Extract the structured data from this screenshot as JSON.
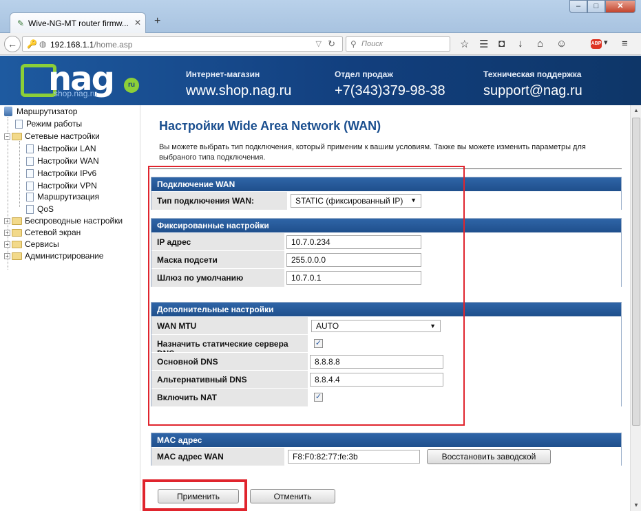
{
  "browser": {
    "tab_title": "Wive-NG-MT router firmw...",
    "url_host": "192.168.1.1",
    "url_path": "/home.asp",
    "search_placeholder": "Поиск"
  },
  "banner": {
    "logo_text": "nag",
    "logo_site": "shop.nag.ru",
    "logo_badge": "ru",
    "col1_head": "Интернет-магазин",
    "col1_val": "www.shop.nag.ru",
    "col2_head": "Отдел продаж",
    "col2_val": "+7(343)379-98-38",
    "col3_head": "Техническая поддержка",
    "col3_val": "support@nag.ru"
  },
  "sidebar": {
    "root": "Маршрутизатор",
    "items": [
      "Режим работы",
      "Сетевые настройки",
      "Настройки LAN",
      "Настройки WAN",
      "Настройки IPv6",
      "Настройки VPN",
      "Маршрутизация",
      "QoS",
      "Беспроводные настройки",
      "Сетевой экран",
      "Сервисы",
      "Администрирование"
    ]
  },
  "page": {
    "title": "Настройки Wide Area Network (WAN)",
    "description": "Вы можете выбрать тип подключения, который применим к вашим условиям. Также вы можете изменить параметры для выбраного типа подключения."
  },
  "wan": {
    "header": "Подключение WAN",
    "type_label": "Тип подключения WAN:",
    "type_value": "STATIC (фиксированный IP)"
  },
  "fixed": {
    "header": "Фиксированные настройки",
    "ip_label": "IP адрес",
    "ip_value": "10.7.0.234",
    "mask_label": "Маска подсети",
    "mask_value": "255.0.0.0",
    "gw_label": "Шлюз по умолчанию",
    "gw_value": "10.7.0.1"
  },
  "extra": {
    "header": "Дополнительные настройки",
    "mtu_label": "WAN MTU",
    "mtu_value": "AUTO",
    "static_dns_label": "Назначить статические сервера DNS",
    "static_dns_checked": true,
    "dns1_label": "Основной DNS",
    "dns1_value": "8.8.8.8",
    "dns2_label": "Альтернативный DNS",
    "dns2_value": "8.8.4.4",
    "nat_label": "Включить NAT",
    "nat_checked": true
  },
  "mac": {
    "header": "MAC адрес",
    "label": "MAC адрес WAN",
    "value": "F8:F0:82:77:fe:3b",
    "restore_button": "Восстановить заводской"
  },
  "actions": {
    "apply": "Применить",
    "cancel": "Отменить"
  },
  "colors": {
    "accent": "#1b4f8f",
    "section_header": "#2a5ea0",
    "highlight": "#e0242d"
  }
}
